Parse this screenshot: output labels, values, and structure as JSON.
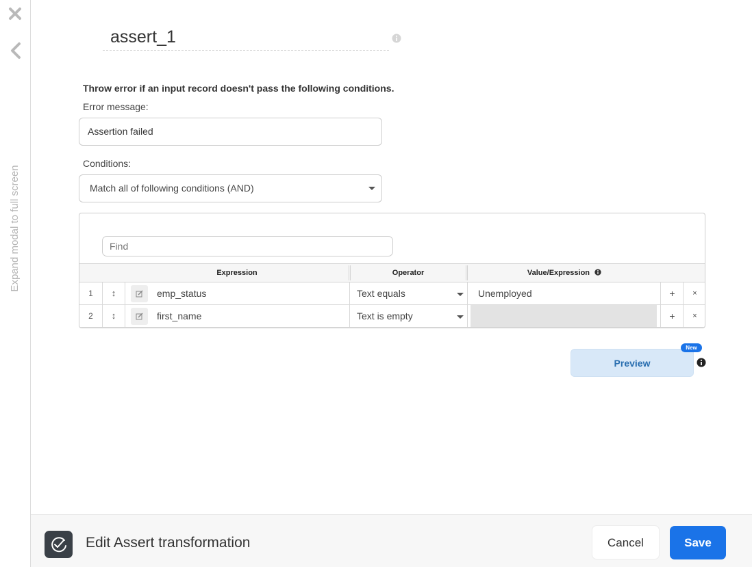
{
  "side_rail": {
    "close_icon": "close-icon",
    "back_icon": "chevron-left-icon",
    "expand_label": "Expand modal to full screen"
  },
  "header": {
    "title": "assert_1",
    "info_icon": "info-icon"
  },
  "form": {
    "instruction": "Throw error if an input record doesn't pass the following conditions.",
    "error_message_label": "Error message:",
    "error_message_value": "Assertion failed",
    "conditions_label": "Conditions:",
    "conditions_selected": "Match all of following conditions (AND)"
  },
  "grid": {
    "find_placeholder": "Find",
    "columns": [
      "Expression",
      "Operator",
      "Value/Expression"
    ],
    "rows": [
      {
        "num": "1",
        "expression": "emp_status",
        "operator": "Text equals",
        "value": "Unemployed"
      },
      {
        "num": "2",
        "expression": "first_name",
        "operator": "Text is empty",
        "value": ""
      }
    ],
    "add_symbol": "+",
    "delete_symbol": "×",
    "drag_symbol": "↕"
  },
  "preview": {
    "label": "Preview",
    "badge": "New"
  },
  "footer": {
    "icon": "check-circle-icon",
    "title": "Edit Assert transformation",
    "cancel_label": "Cancel",
    "save_label": "Save"
  },
  "colors": {
    "primary": "#1a73e8",
    "preview_bg": "#d8e8f8",
    "footer_icon_bg": "#3a4047"
  }
}
